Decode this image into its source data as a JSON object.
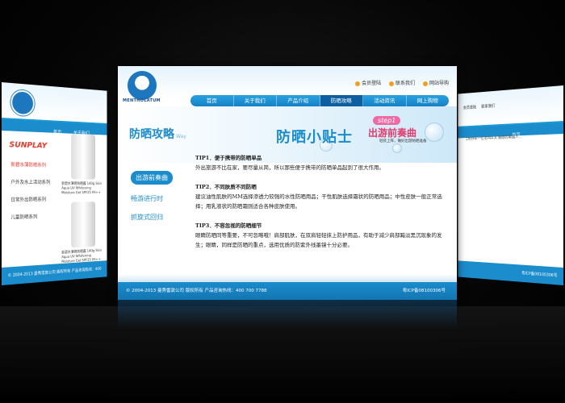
{
  "main": {
    "brand": "MENTHOLATUM",
    "top_links": [
      "会员登陆",
      "联系我们",
      "网站导购"
    ],
    "nav": [
      "首页",
      "关于我们",
      "产品介绍",
      "防晒攻略",
      "活动资讯",
      "网上购物"
    ],
    "active_nav": 3,
    "section_title": "防晒攻略",
    "section_title_sub": "Way",
    "headline": "防晒小贴士",
    "step_tag": "step1",
    "step_big": "出游前奏曲",
    "step_sub": "轻装上阵，做好出游防晒准备",
    "menu": [
      "出游前奏曲",
      "畅游进行时",
      "抓旋式回归"
    ],
    "tips": [
      {
        "h": "TIP1．便于携带的防晒单品",
        "t": "外出旅游不比在家，要尽量从简，所以那些便于携带的防晒单品起到了很大作用。"
      },
      {
        "h": "TIP2．不同肤质不同防晒",
        "t": "建议油性肌肤的MM选择渗透力较强的水性防晒用品；干性肌肤选择霜状的防晒用品；中性皮肤一般正常选择；用乳液状的防晒霜则适合各种皮肤使用。"
      },
      {
        "h": "TIP3．不容忽视的防晒细节",
        "t": "眼睛防晒同等重要，不可忽略哦！肩部肌肤，在双肩轻轻抹上防护用品，有助于减少肩部黯淡黑沉现象的发生；眼睛，同样是防晒的重点，选用优质的防紫外线墨镜十分必要。"
      }
    ],
    "footer_left": "© 2004-2013  曼秀雷敦公司  版权所有  产品咨询热线：400 700 7788",
    "footer_right": "粤ICP备08100306号"
  },
  "left": {
    "nav": [
      "首页",
      "关于我们"
    ],
    "logo_text": "SUNPLAY",
    "menu": [
      "新碧水薄防晒系列",
      "户外及水上活动系列",
      "日常外出防晒系列",
      "儿童防晒系列"
    ],
    "product1": "新碧水薄荷防晒露 140g Skin Aqua UV Whitening Moisture Gel SPF25 PA++",
    "product2": "新碧水薄荷防晒露 140g Skin Aqua UV Whitening Moisture Gel SPF25 PA++",
    "footer": "© 2004-2013 曼秀雷敦公司 版权所有 产品咨询热线：400 700 7788"
  },
  "right": {
    "top_links": [
      "会员登陆",
      "联系我们"
    ],
    "nav": [
      "首页"
    ],
    "text": "1889年一位名叫A.A.海德的美国人...",
    "footer": "粤ICP备08100306号"
  }
}
